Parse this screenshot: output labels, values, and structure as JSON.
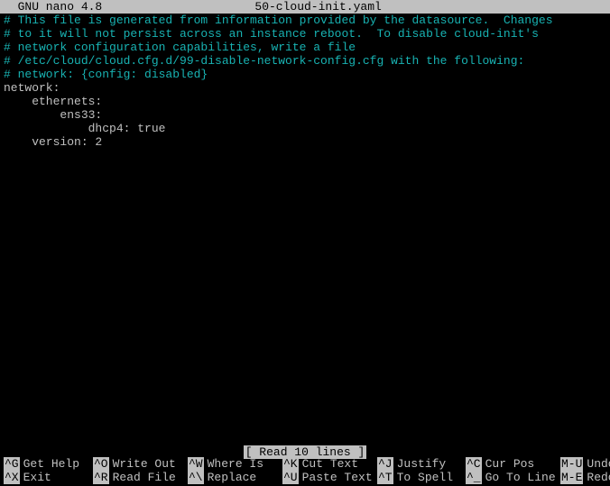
{
  "titlebar": {
    "app": "  GNU nano 4.8",
    "filename": "50-cloud-init.yaml"
  },
  "content": {
    "lines": [
      {
        "cls": "comment",
        "text": "# This file is generated from information provided by the datasource.  Changes"
      },
      {
        "cls": "comment",
        "text": "# to it will not persist across an instance reboot.  To disable cloud-init's"
      },
      {
        "cls": "comment",
        "text": "# network configuration capabilities, write a file"
      },
      {
        "cls": "comment",
        "text": "# /etc/cloud/cloud.cfg.d/99-disable-network-config.cfg with the following:"
      },
      {
        "cls": "comment",
        "text": "# network: {config: disabled}"
      },
      {
        "cls": "plain",
        "text": "network:"
      },
      {
        "cls": "plain",
        "text": "    ethernets:"
      },
      {
        "cls": "plain",
        "text": "        ens33:"
      },
      {
        "cls": "plain",
        "text": "            dhcp4: true"
      },
      {
        "cls": "plain",
        "text": "    version: 2"
      }
    ]
  },
  "status": "[ Read 10 lines ]",
  "shortcuts": {
    "row1": [
      {
        "key": "^G",
        "desc": "Get Help"
      },
      {
        "key": "^O",
        "desc": "Write Out"
      },
      {
        "key": "^W",
        "desc": "Where Is"
      },
      {
        "key": "^K",
        "desc": "Cut Text"
      },
      {
        "key": "^J",
        "desc": "Justify"
      },
      {
        "key": "^C",
        "desc": "Cur Pos"
      },
      {
        "key": "M-U",
        "desc": "Undo"
      }
    ],
    "row2": [
      {
        "key": "^X",
        "desc": "Exit"
      },
      {
        "key": "^R",
        "desc": "Read File"
      },
      {
        "key": "^\\",
        "desc": "Replace"
      },
      {
        "key": "^U",
        "desc": "Paste Text"
      },
      {
        "key": "^T",
        "desc": "To Spell"
      },
      {
        "key": "^_",
        "desc": "Go To Line"
      },
      {
        "key": "M-E",
        "desc": "Redo"
      }
    ]
  }
}
